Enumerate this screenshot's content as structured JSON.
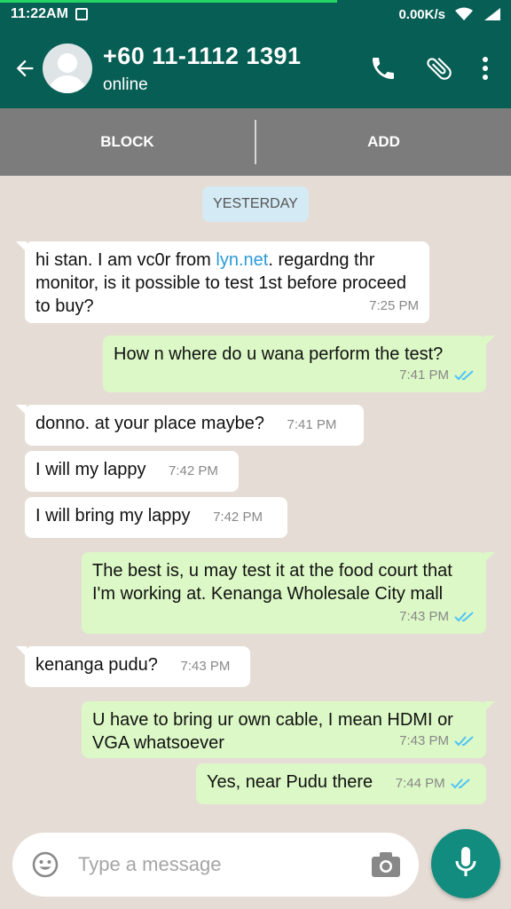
{
  "status_bar": {
    "time": "11:22AM",
    "network_speed": "0.00K/s"
  },
  "header": {
    "contact_name": "+60 11-1112 1391",
    "contact_status": "online",
    "icons": [
      "back-arrow-icon",
      "avatar",
      "phone-icon",
      "attach-icon",
      "more-vert-icon"
    ]
  },
  "action_bar": {
    "block_label": "BLOCK",
    "add_label": "ADD"
  },
  "chat": {
    "date_label": "YESTERDAY",
    "messages": [
      {
        "dir": "in",
        "text_pre": "hi stan. I am vc0r from ",
        "link": "lyn.net",
        "text_post": ". regardng thr monitor, is it possible to test 1st before proceed to buy?",
        "time": "7:25 PM"
      },
      {
        "dir": "out",
        "text": "How n where do u wana perform the test?",
        "time": "7:41 PM"
      },
      {
        "dir": "in",
        "text": "donno. at your place maybe?",
        "time": "7:41 PM"
      },
      {
        "dir": "in",
        "text": "I will my lappy",
        "time": "7:42 PM"
      },
      {
        "dir": "in",
        "text": "I will bring my lappy",
        "time": "7:42 PM"
      },
      {
        "dir": "out",
        "text": "The best is, u may test it at the food court that I'm working at. Kenanga Wholesale City mall",
        "time": "7:43 PM"
      },
      {
        "dir": "in",
        "text": "kenanga pudu?",
        "time": "7:43 PM"
      },
      {
        "dir": "out",
        "text": "U have to bring ur own cable, I mean HDMI or VGA whatsoever",
        "time": "7:43 PM"
      },
      {
        "dir": "out",
        "text": "Yes, near Pudu there",
        "time": "7:44 PM"
      }
    ]
  },
  "composer": {
    "placeholder": "Type a message"
  },
  "colors": {
    "header": "#075e54",
    "outgoing_bubble": "#dcf8c6",
    "incoming_bubble": "#ffffff",
    "chat_bg": "#e5ddd5",
    "mic_button": "#128c7e",
    "read_tick": "#4fc3f7"
  }
}
